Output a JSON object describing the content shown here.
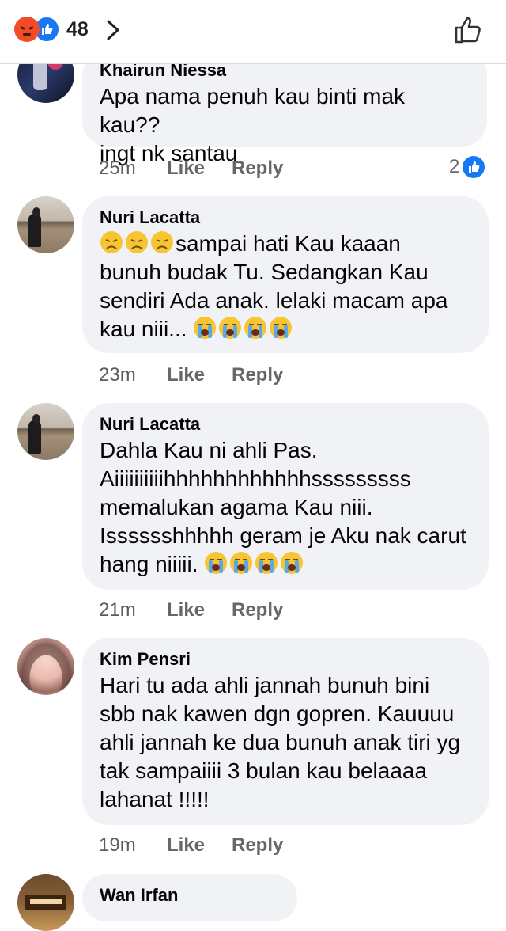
{
  "header": {
    "reaction_count": "48",
    "icons": [
      "angry-reaction-icon",
      "like-reaction-icon",
      "chevron-right-icon",
      "thumbs-up-outline-icon"
    ]
  },
  "comments": [
    {
      "name": "Khairun Niessa",
      "text": "Apa nama penuh kau binti mak kau??\ningt nk santau",
      "time": "25m",
      "like_label": "Like",
      "reply_label": "Reply",
      "like_count": "2"
    },
    {
      "name": "Nuri Lacatta",
      "text_part1": "sampai hati Kau kaaan\nbunuh budak Tu. Sedangkan Kau\nsendiri Ada anak. lelaki macam apa\nkau niii...",
      "time": "23m",
      "like_label": "Like",
      "reply_label": "Reply"
    },
    {
      "name": "Nuri Lacatta",
      "text": "Dahla Kau ni ahli Pas.\nAiiiiiiiiiihhhhhhhhhhhhsssssssss\nmemalukan agama Kau niii.\nIsssssshhhhh geram je Aku nak carut\nhang niiiii.",
      "time": "21m",
      "like_label": "Like",
      "reply_label": "Reply"
    },
    {
      "name": "Kim Pensri",
      "text": "Hari tu ada ahli jannah bunuh bini\nsbb nak kawen dgn gopren. Kauuuu\nahli jannah ke dua bunuh anak tiri yg\ntak sampaiiii 3 bulan kau belaaaa\nlahanat !!!!!",
      "time": "19m",
      "like_label": "Like",
      "reply_label": "Reply"
    },
    {
      "name": "Wan Irfan"
    }
  ],
  "colors": {
    "bubble": "#f0f2f5",
    "meta_text": "#65676b",
    "like_blue": "#1877f2",
    "angry_orange": "#f24b28"
  }
}
